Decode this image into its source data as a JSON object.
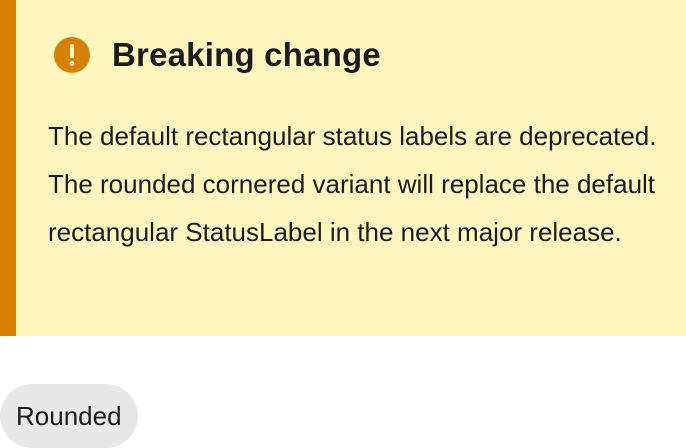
{
  "alert": {
    "icon": "exclamation-circle-icon",
    "title": "Breaking change",
    "body": "The default rectangular status labels are deprecated. The rounded cornered variant will replace the default rectangular StatusLabel in the next major release."
  },
  "status_label": {
    "text": "Rounded"
  },
  "colors": {
    "alert_background": "#fff5bf",
    "alert_accent": "#d48000",
    "status_label_background": "#e8e8e8",
    "text": "#1c1c1c"
  }
}
